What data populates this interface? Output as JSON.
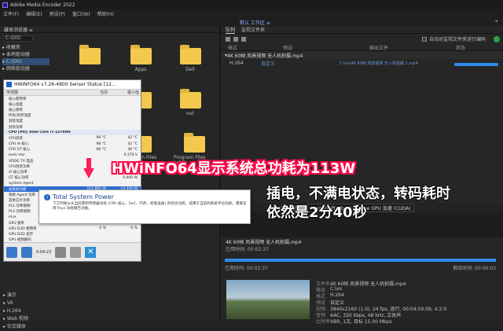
{
  "window": {
    "title": "Adobe Media Encoder 2022"
  },
  "menu": [
    "文件(F)",
    "编辑(E)",
    "预设(P)",
    "窗口(W)",
    "帮助(H)"
  ],
  "preset_bar": {
    "center": "默认 工作区 ≡"
  },
  "media_browser": {
    "header": "媒体浏览器 ≡",
    "drive": "C:(OS)",
    "tree": [
      "▸ 收藏夹",
      "▾ 本地驱动器",
      "  ▸ C:(OS)",
      "▸ 网络驱动器"
    ],
    "folders": [
      {
        "name": ""
      },
      {
        "name": "Apps"
      },
      {
        "name": "Dell"
      },
      {
        "name": ""
      },
      {
        "name": ""
      },
      {
        "name": "out"
      },
      {
        "name": ""
      },
      {
        "name": "Program Files"
      },
      {
        "name": "Program Files (x86)"
      }
    ],
    "lower_tree": [
      "▸ 演示",
      "▸ VK",
      "  ▸ H.264",
      "▸ Web 视频",
      "  ▸ 社交媒体"
    ]
  },
  "queue": {
    "tabs": [
      "队列",
      "监视文件夹"
    ],
    "auto_encode_label": "自动对监视文件夹进行编码",
    "columns": [
      "格式",
      "预设",
      "输出文件",
      "状态"
    ],
    "item": "4K 60帧 风景视频 无人机拍摄.mp4",
    "sub_item": "H.264",
    "sub_preset": "自定义",
    "output": "C:\\xx\\4K 60帧 风景视频 无人机拍摄 1.mp4"
  },
  "playback": {
    "renderer_label": "渲染程序:",
    "renderer": "Mercury Playback Engine GPU 加速 (CUDA)",
    "encoding_title": "编码",
    "file": "4K 60帧 风景视频 无人机拍摄.mp4",
    "elapsed": "已用时间: 00:02:37",
    "remaining": "剩余时间: 00:00:03",
    "meta": [
      {
        "k": "文件名",
        "v": "4K 60帧 风景视频 无人机拍摄.mp4"
      },
      {
        "k": "路径",
        "v": "C:\\xx"
      },
      {
        "k": "格式",
        "v": "H.264"
      },
      {
        "k": "预设",
        "v": "自定义"
      },
      {
        "k": "视频",
        "v": "3840x2160 (1.0), 24 fps, 逐行, 00:04:59:09, 4:2:0"
      },
      {
        "k": "音频",
        "v": "AAC, 320 kbps, 48 kHz, 立体声"
      },
      {
        "k": "比特率",
        "v": "VBR, 1次, 目标 15.00 Mbps"
      }
    ]
  },
  "hwinfo": {
    "title": "HWiNFO64 v7.26-4800 Sensor Status [12...",
    "columns": [
      "传感器",
      "当前",
      "最小值"
    ],
    "rows": [
      {
        "n": "核心使用率",
        "a": "",
        "b": ""
      },
      {
        "n": "核心温度",
        "a": "",
        "b": ""
      },
      {
        "n": "核心频率",
        "a": "",
        "b": ""
      },
      {
        "n": "环形/内存温度",
        "a": "",
        "b": ""
      },
      {
        "n": "封装温度",
        "a": "",
        "b": ""
      },
      {
        "n": "封装功率",
        "a": "",
        "b": ""
      },
      {
        "n": "CPU [#0]: Intel Core i7-12700H",
        "a": "",
        "b": "",
        "sec": true
      },
      {
        "n": "CPU封装",
        "a": "98 °C",
        "b": "42 °C"
      },
      {
        "n": "CPU IA 核心",
        "a": "98 °C",
        "b": "42 °C"
      },
      {
        "n": "CPU GT 核心",
        "a": "68 °C",
        "b": "40 °C"
      },
      {
        "n": "IGPU VID",
        "a": "",
        "b": "0.370 V"
      },
      {
        "n": "VDDQ TX 电压",
        "a": "",
        "b": ""
      },
      {
        "n": "CPU封装功率",
        "a": "",
        "b": "9.127 W"
      },
      {
        "n": "IA 核心功率",
        "a": "",
        "b": "5.041 W"
      },
      {
        "n": "GT 核心功率",
        "a": "",
        "b": "0.000 W"
      },
      {
        "n": "System Agent",
        "a": "",
        "b": ""
      },
      {
        "n": "总系统功耗",
        "a": "112.882 W",
        "b": "14.344 W",
        "hl": true
      },
      {
        "n": "系统 Agent 功率",
        "a": "",
        "b": ""
      },
      {
        "n": "其余芯片功率",
        "a": "",
        "b": ""
      },
      {
        "n": "PL1 功率限制",
        "a": "",
        "b": ""
      },
      {
        "n": "PL2 功率限制",
        "a": "",
        "b": ""
      },
      {
        "n": "PCH",
        "a": "",
        "b": ""
      },
      {
        "n": "GPU 频率",
        "a": "1,296.8 MHz",
        "b": "99.8 MHz"
      },
      {
        "n": "GPU D3D 使用率",
        "a": "0 %",
        "b": "0 %"
      },
      {
        "n": "GPU D3D 显存",
        "a": "",
        "b": ""
      },
      {
        "n": "GPU 视频解码",
        "a": "",
        "b": ""
      },
      {
        "n": "GPU 功耗",
        "a": "",
        "b": ""
      }
    ],
    "footer_time": "0:04:23"
  },
  "tooltip": {
    "title": "Total System Power",
    "body": "下方列举从头当前累积传感器功耗 (CPU 核心、SoC、内存、耗电设备) 的综合功耗。适用于当前的系统平台功耗。需要支持 Psys 功耗报告功能。"
  },
  "overlay": {
    "line1": "HWiNFO64显示系统总功耗为113W",
    "line2": "插电，不满电状态，转码耗时",
    "line3": "依然是2分40秒"
  }
}
